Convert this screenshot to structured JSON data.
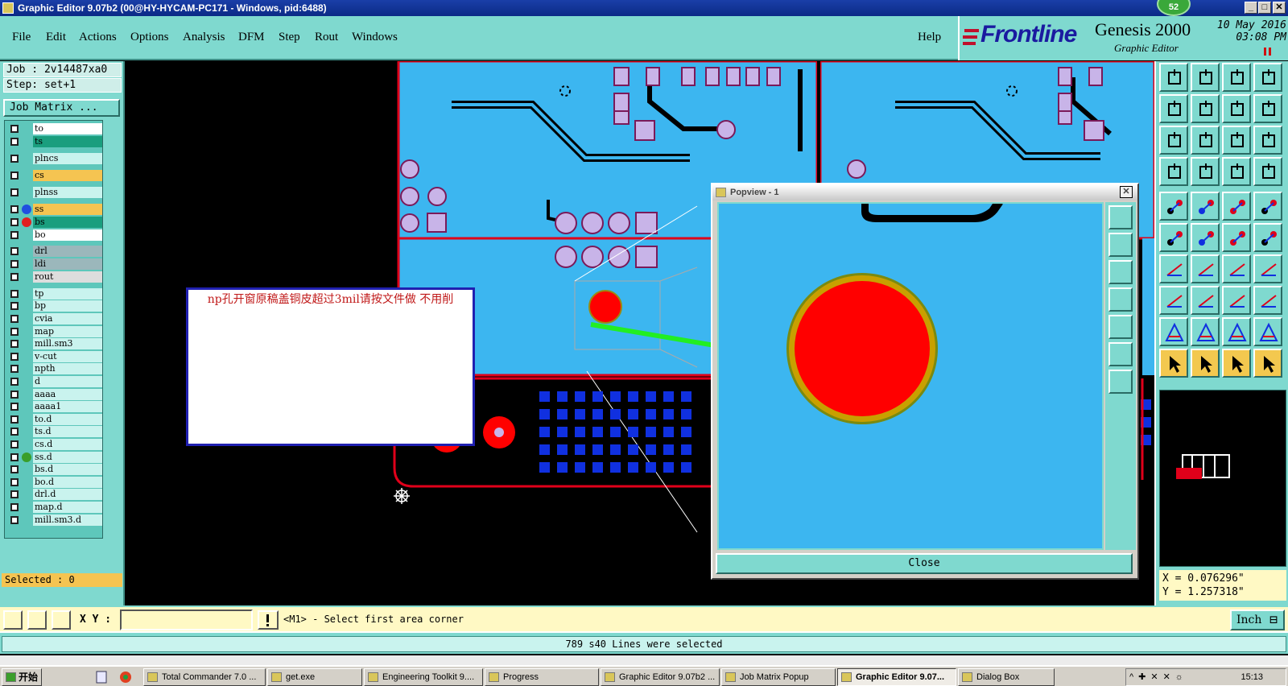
{
  "window": {
    "title": "Graphic Editor 9.07b2 (00@HY-HYCAM-PC171 - Windows, pid:6488)",
    "badge": "52",
    "minimize": "_",
    "maximize": "□",
    "close": "✕"
  },
  "menu": [
    "File",
    "Edit",
    "Actions",
    "Options",
    "Analysis",
    "DFM",
    "Step",
    "Rout",
    "Windows"
  ],
  "help": "Help",
  "logo": {
    "brand": "Frontline",
    "product": "Genesis 2000",
    "subtitle": "Graphic Editor",
    "date": "10 May 2016",
    "time": "03:08 PM"
  },
  "job": {
    "job_label": "Job : 2v14487xa0",
    "step_label": "Step: set+1",
    "matrix_button": "Job Matrix ..."
  },
  "layers": [
    {
      "name": "to",
      "color": "#ffffff",
      "dot": ""
    },
    {
      "name": "ts",
      "color": "#1a9e7e",
      "dot": ""
    },
    {
      "name": "plncs",
      "color": "#c9f3ee",
      "dot": ""
    },
    {
      "name": "cs",
      "color": "#f5c451",
      "dot": ""
    },
    {
      "name": "plnss",
      "color": "#c9f3ee",
      "dot": ""
    },
    {
      "name": "ss",
      "color": "#f5c451",
      "dot": "#2050e0"
    },
    {
      "name": "bs",
      "color": "#1a9e7e",
      "dot": "#e02020"
    },
    {
      "name": "bo",
      "color": "#ffffff",
      "dot": ""
    },
    {
      "name": "drl",
      "color": "#9bb7bb",
      "dot": ""
    },
    {
      "name": "ldi",
      "color": "#9bb7bb",
      "dot": ""
    },
    {
      "name": "rout",
      "color": "#dddddd",
      "dot": ""
    },
    {
      "name": "tp",
      "color": "#c9f3ee",
      "dot": ""
    },
    {
      "name": "bp",
      "color": "#c9f3ee",
      "dot": ""
    },
    {
      "name": "cvia",
      "color": "#c9f3ee",
      "dot": ""
    },
    {
      "name": "map",
      "color": "#c9f3ee",
      "dot": ""
    },
    {
      "name": "mill.sm3",
      "color": "#c9f3ee",
      "dot": ""
    },
    {
      "name": "v-cut",
      "color": "#c9f3ee",
      "dot": ""
    },
    {
      "name": "npth",
      "color": "#c9f3ee",
      "dot": ""
    },
    {
      "name": "d",
      "color": "#c9f3ee",
      "dot": ""
    },
    {
      "name": "aaaa",
      "color": "#c9f3ee",
      "dot": ""
    },
    {
      "name": "aaaa1",
      "color": "#c9f3ee",
      "dot": ""
    },
    {
      "name": "to.d",
      "color": "#c9f3ee",
      "dot": ""
    },
    {
      "name": "ts.d",
      "color": "#c9f3ee",
      "dot": ""
    },
    {
      "name": "cs.d",
      "color": "#c9f3ee",
      "dot": ""
    },
    {
      "name": "ss.d",
      "color": "#c9f3ee",
      "dot": "#3a9e2a"
    },
    {
      "name": "bs.d",
      "color": "#c9f3ee",
      "dot": ""
    },
    {
      "name": "bo.d",
      "color": "#c9f3ee",
      "dot": ""
    },
    {
      "name": "drl.d",
      "color": "#c9f3ee",
      "dot": ""
    },
    {
      "name": "map.d",
      "color": "#c9f3ee",
      "dot": ""
    },
    {
      "name": "mill.sm3.d",
      "color": "#c9f3ee",
      "dot": ""
    }
  ],
  "selected_label": "Selected : 0",
  "annotation": "np孔开窗原稿盖铜皮超过3mil请按文件做  不用削",
  "popview": {
    "title": "Popview - 1",
    "close_label": "Close"
  },
  "coords": {
    "x": "X = 0.076296\"",
    "y": "Y = 1.257318\""
  },
  "command": {
    "xy_label": "X Y :",
    "xy_value": "",
    "prompt": "<M1> - Select first area corner",
    "unit": "Inch"
  },
  "status": "789 s40 Lines were selected",
  "taskbar": {
    "start": "开始",
    "items": [
      "Total Commander 7.0 ...",
      "get.exe",
      "Engineering Toolkit 9....",
      "Progress",
      "Graphic Editor 9.07b2 ...",
      "Job Matrix Popup",
      "Graphic Editor 9.07...",
      "Dialog Box"
    ],
    "active_index": 6,
    "clock": "15:13"
  },
  "colors": {
    "panel": "#7fd9cf",
    "board": "#3cb6f0",
    "pad": "#c8b4e8",
    "copper_outline": "#e0001a",
    "highlight_pad": "#ff0000"
  },
  "icons": [
    "home-icon",
    "zoom-icon",
    "measure-icon",
    "select-arrow-icon"
  ]
}
